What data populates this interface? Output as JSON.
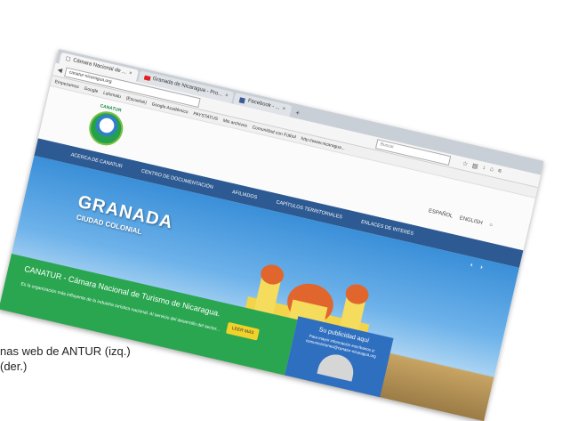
{
  "caption": {
    "line1": "nas web de ANTUR (izq.)",
    "line2": "(der.)"
  },
  "browser": {
    "tabs": [
      {
        "label": "Cámara Nacional de ...",
        "icon": "page-icon",
        "active": true
      },
      {
        "label": "Granada de Nicaragua - Pro...",
        "icon": "youtube-icon",
        "active": false
      },
      {
        "label": "Facebook - ...",
        "icon": "facebook-icon",
        "active": false
      }
    ],
    "new_tab_label": "+",
    "url": "canatur-nicaragua.org",
    "search_placeholder": "Buscar",
    "bookmarks": [
      "Empezamos",
      "Google",
      "Lalomalu",
      "(Escuelas)",
      "Google Académico",
      "PAYSTATUS",
      "Mis archivos",
      "Comunidad con Fútbol",
      "http://www.nicaragua..."
    ]
  },
  "site": {
    "logo_name": "CANATUR",
    "top_links": [
      "ESPAÑOL",
      "ENGLISH"
    ],
    "nav": [
      "ACERCA DE CANATUR",
      "CENTRO DE DOCUMENTACIÓN",
      "AFILIADOS",
      "CAPÍTULOS TERRITORIALES",
      "ENLACES DE INTERÉS"
    ],
    "hero_title": "GRANADA",
    "hero_subtitle": "CIUDAD COLONIAL",
    "green_title": "CANATUR - Cámara Nacional de Turismo de Nicaragua.",
    "green_text": "Es la organización más influyente de la industria turística nacional. Al servicio del desarrollo del sector...",
    "more_label": "LEER MÁS",
    "ad_title": "Su publicidad aquí",
    "ad_text": "Para mayor información escríbanos a: comunicaciones@canatur-nicaragua.org"
  }
}
